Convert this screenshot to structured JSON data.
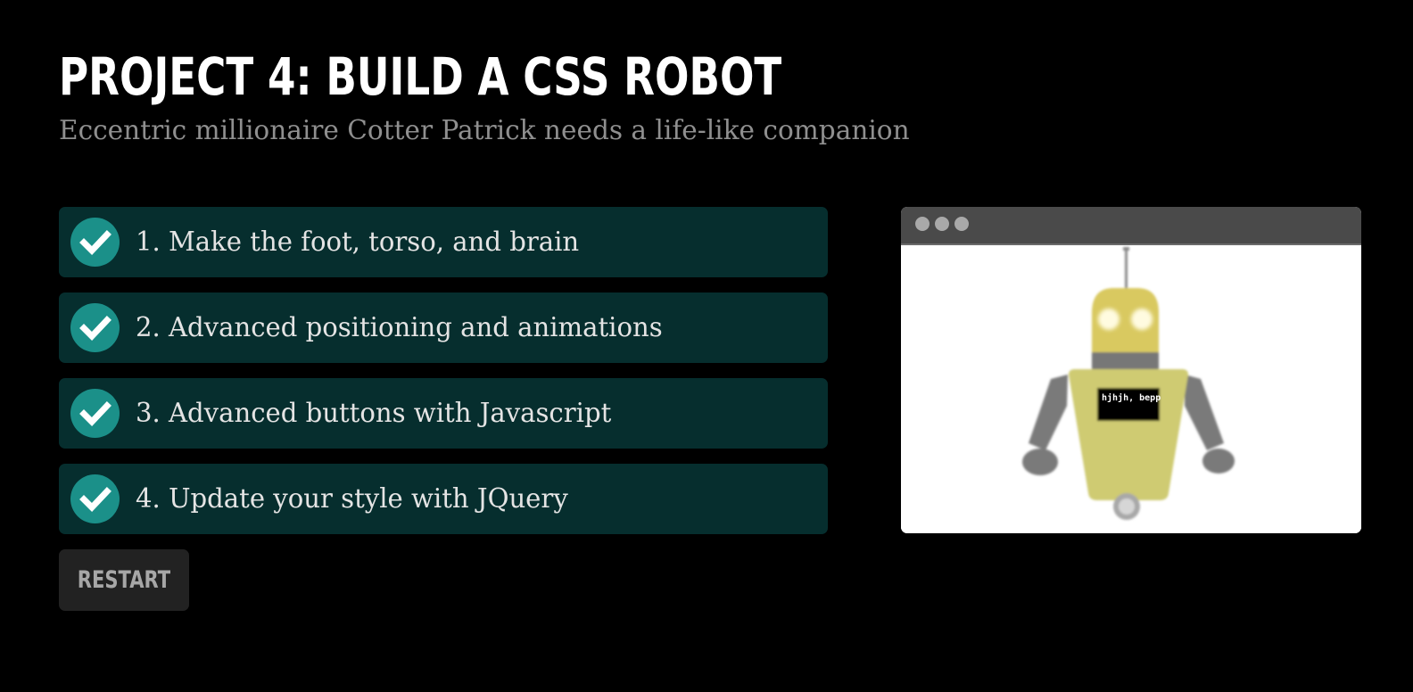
{
  "header": {
    "title": "PROJECT 4: BUILD A CSS ROBOT",
    "subtitle": "Eccentric millionaire Cotter Patrick needs a life-like companion"
  },
  "steps": [
    {
      "label": "1. Make the foot, torso, and brain",
      "completed": true,
      "icon": "check-icon"
    },
    {
      "label": "2. Advanced positioning and animations",
      "completed": true,
      "icon": "check-icon"
    },
    {
      "label": "3. Advanced buttons with Javascript",
      "completed": true,
      "icon": "check-icon"
    },
    {
      "label": "4. Update your style with JQuery",
      "completed": true,
      "icon": "check-icon"
    }
  ],
  "restart_button": {
    "label": "RESTART"
  },
  "preview": {
    "robot_screen_text": "hjhjh, bepp"
  },
  "colors": {
    "background": "#000000",
    "step_background": "#062e2e",
    "check_accent": "#1b9089",
    "robot_head": "#d9c960",
    "robot_torso": "#cfcb72",
    "robot_limbs": "#7a7a7a"
  }
}
